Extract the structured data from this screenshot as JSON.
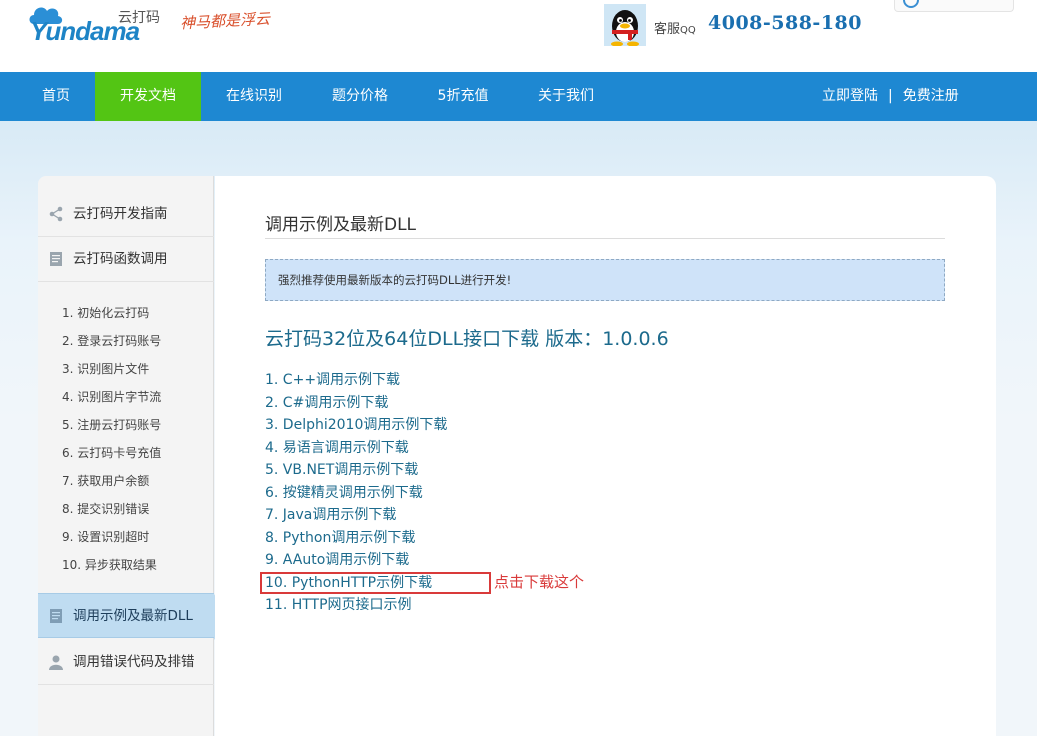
{
  "header": {
    "logo_word": "Yundama",
    "logo_cn": "云打码",
    "slogan": "神马都是浮云",
    "qq_label": "客服",
    "qq_label_small": "QQ",
    "qq_number": "4008-588-180"
  },
  "nav": {
    "items": [
      {
        "label": "首页"
      },
      {
        "label": "开发文档"
      },
      {
        "label": "在线识别"
      },
      {
        "label": "题分价格"
      },
      {
        "label": "5折充值"
      },
      {
        "label": "关于我们"
      }
    ],
    "login": "立即登陆",
    "separator": "|",
    "register": "免费注册"
  },
  "sidebar": {
    "sections": [
      {
        "label": "云打码开发指南",
        "icon": "share-icon"
      },
      {
        "label": "云打码函数调用",
        "icon": "document-icon"
      },
      {
        "label": "调用示例及最新DLL",
        "icon": "document-icon"
      },
      {
        "label": "调用错误代码及排错",
        "icon": "user-icon"
      }
    ],
    "sub_items": [
      "1. 初始化云打码",
      "2. 登录云打码账号",
      "3. 识别图片文件",
      "4. 识别图片字节流",
      "5. 注册云打码账号",
      "6. 云打码卡号充值",
      "7. 获取用户余额",
      "8. 提交识别错误",
      "9. 设置识别超时",
      "10. 异步获取结果"
    ]
  },
  "content": {
    "title": "调用示例及最新DLL",
    "notice": "强烈推荐使用最新版本的云打码DLL进行开发!",
    "dll_title": "云打码32位及64位DLL接口下载 版本：1.0.0.6",
    "links": [
      "1. C++调用示例下载",
      "2. C#调用示例下载",
      "3. Delphi2010调用示例下载",
      "4. 易语言调用示例下载",
      "5. VB.NET调用示例下载",
      "6. 按键精灵调用示例下载",
      "7. Java调用示例下载",
      "8. Python调用示例下载",
      "9. AAuto调用示例下载",
      "10. PythonHTTP示例下载",
      "11. HTTP网页接口示例"
    ],
    "highlight_note": "点击下载这个"
  },
  "colors": {
    "nav_bg": "#1e88d2",
    "nav_active": "#53c514",
    "link": "#1c6a8c",
    "highlight": "#d93a3a"
  }
}
